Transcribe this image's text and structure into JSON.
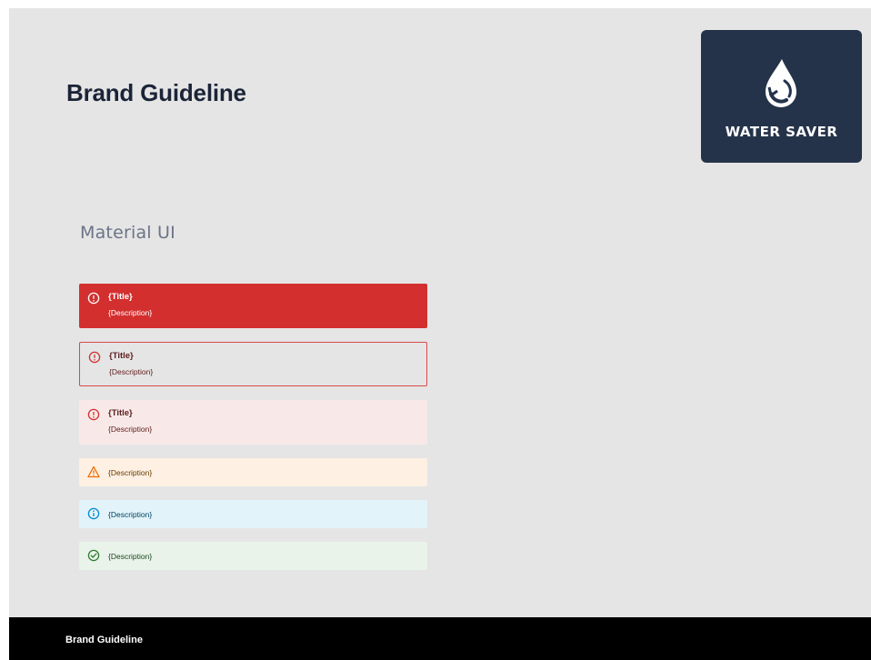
{
  "header": {
    "title": "Brand Guideline"
  },
  "logo": {
    "text": "WATER SAVER",
    "icon": "water-drop-icon"
  },
  "section": {
    "title": "Material UI"
  },
  "alerts": [
    {
      "variant": "filled-error",
      "icon": "error-outline-icon",
      "title": "{Title}",
      "description": "{Description}"
    },
    {
      "variant": "outlined-error",
      "icon": "error-outline-icon",
      "title": "{Title}",
      "description": "{Description}"
    },
    {
      "variant": "standard-error",
      "icon": "error-outline-icon",
      "title": "{Title}",
      "description": "{Description}"
    },
    {
      "variant": "standard-warning",
      "icon": "warning-icon",
      "description": "{Description}"
    },
    {
      "variant": "standard-info",
      "icon": "info-icon",
      "description": "{Description}"
    },
    {
      "variant": "standard-success",
      "icon": "success-icon",
      "description": "{Description}"
    }
  ],
  "footer": {
    "title": "Brand Guideline"
  },
  "colors": {
    "page_bg": "#e5e5e5",
    "logo_bg": "#25334a",
    "error": "#d32f2f",
    "warning": "#ef6c00",
    "info": "#0288d1",
    "success": "#2e7d32",
    "footer_bg": "#000000"
  }
}
